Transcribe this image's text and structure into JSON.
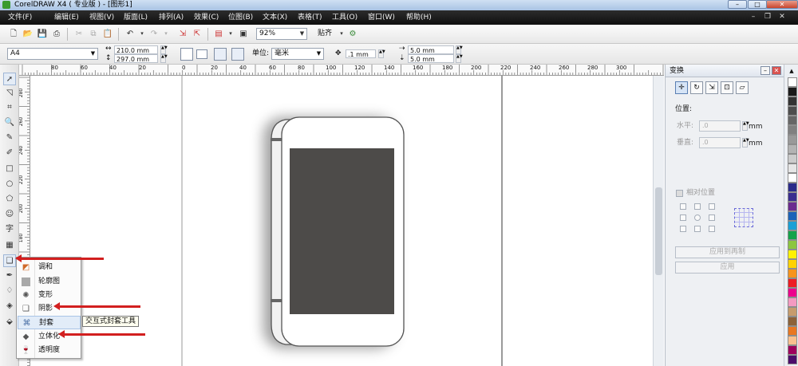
{
  "window": {
    "title": "CorelDRAW X4 ( 专业版 ) - [图形1]",
    "controls": {
      "minimize": "–",
      "maximize": "□",
      "close": "✕"
    }
  },
  "menubar": {
    "items": [
      "文件(F)",
      "编辑(E)",
      "视图(V)",
      "版面(L)",
      "排列(A)",
      "效果(C)",
      "位图(B)",
      "文本(X)",
      "表格(T)",
      "工具(O)",
      "窗口(W)",
      "帮助(H)"
    ]
  },
  "toolbar": {
    "zoom": "92%",
    "snap_label": "贴齐"
  },
  "propertybar": {
    "page_size": "A4",
    "width": "210.0 mm",
    "height": "297.0 mm",
    "units_label": "单位:",
    "units": "毫米",
    "nudge": ".1 mm",
    "dup_x": "5.0 mm",
    "dup_y": "5.0 mm"
  },
  "ruler": {
    "h_labels": [
      "80",
      "60",
      "40",
      "20",
      "0",
      "20",
      "40",
      "60",
      "80",
      "100",
      "120",
      "140",
      "160",
      "180",
      "200",
      "220",
      "240",
      "260",
      "280",
      "300"
    ],
    "v_labels": [
      "280",
      "260",
      "240",
      "220",
      "200",
      "180",
      "160",
      "140",
      "120"
    ]
  },
  "flyout": {
    "items": [
      {
        "label": "调和",
        "icon": "blend-icon"
      },
      {
        "label": "轮廓图",
        "icon": "contour-icon"
      },
      {
        "label": "变形",
        "icon": "distort-icon"
      },
      {
        "label": "阴影",
        "icon": "drop-shadow-icon"
      },
      {
        "label": "封套",
        "icon": "envelope-icon"
      },
      {
        "label": "立体化",
        "icon": "extrude-icon"
      },
      {
        "label": "透明度",
        "icon": "transparency-icon"
      }
    ],
    "tooltip": "交互式封套工具"
  },
  "docker": {
    "title": "变换",
    "position_label": "位置:",
    "horizontal_label": "水平:",
    "horizontal_value": ".0",
    "vertical_label": "垂直:",
    "vertical_value": ".0",
    "unit": "mm",
    "relative_label": "相对位置",
    "apply_copy_label": "应用到再制",
    "apply_label": "应用"
  },
  "palette": {
    "colors": [
      "#ffffff",
      "#1a1a1a",
      "#333333",
      "#4d4d4d",
      "#666666",
      "#808080",
      "#999999",
      "#b3b3b3",
      "#cccccc",
      "#e6e6e6",
      "#ffffff",
      "#2b2b8a",
      "#3a2d8f",
      "#6b2b8f",
      "#1c63b8",
      "#1aa0d6",
      "#14a34a",
      "#8dc63f",
      "#fff200",
      "#ffd200",
      "#f7941d",
      "#ed1c24",
      "#ec008c",
      "#f49ac1",
      "#c69c6d",
      "#8c6239",
      "#e87722",
      "#f9c08f",
      "#9e005d",
      "#4b0d6b"
    ]
  }
}
